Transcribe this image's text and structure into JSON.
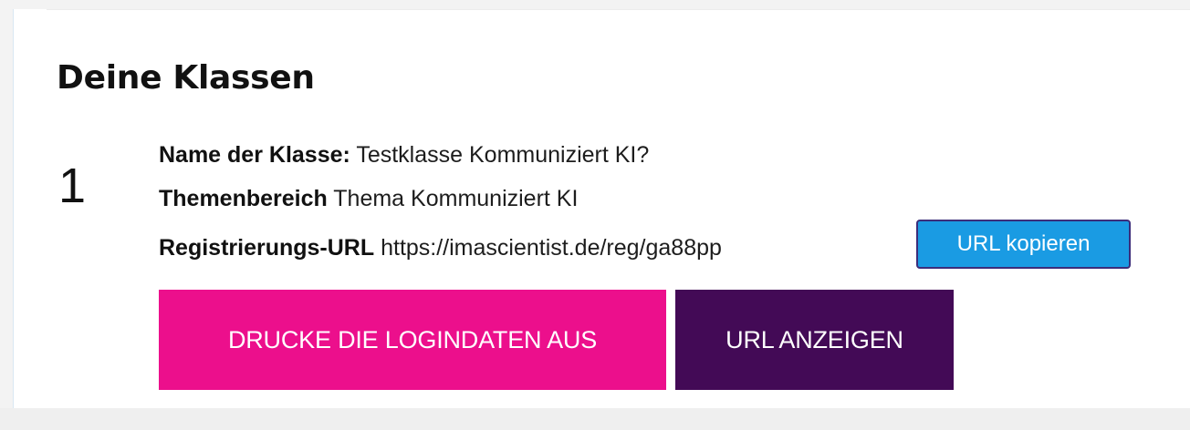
{
  "section": {
    "title": "Deine Klassen"
  },
  "classes": [
    {
      "number": "1",
      "name_label": "Name der Klasse:",
      "name_value": "Testklasse Kommuniziert KI?",
      "theme_label": "Themenbereich",
      "theme_value": "Thema Kommuniziert KI",
      "url_label": "Registrierungs-URL",
      "url_value": "https://imascientist.de/reg/ga88pp",
      "copy_button_label": "URL kopieren",
      "print_button_label": "DRUCKE DIE LOGINDATEN AUS",
      "show_url_button_label": "URL ANZEIGEN"
    }
  ],
  "colors": {
    "copy_button": "#1a9be3",
    "copy_button_border": "#3c2d7a",
    "print_button": "#ec0f8c",
    "show_url_button": "#430a56",
    "text": "#111111",
    "background": "#ffffff"
  }
}
